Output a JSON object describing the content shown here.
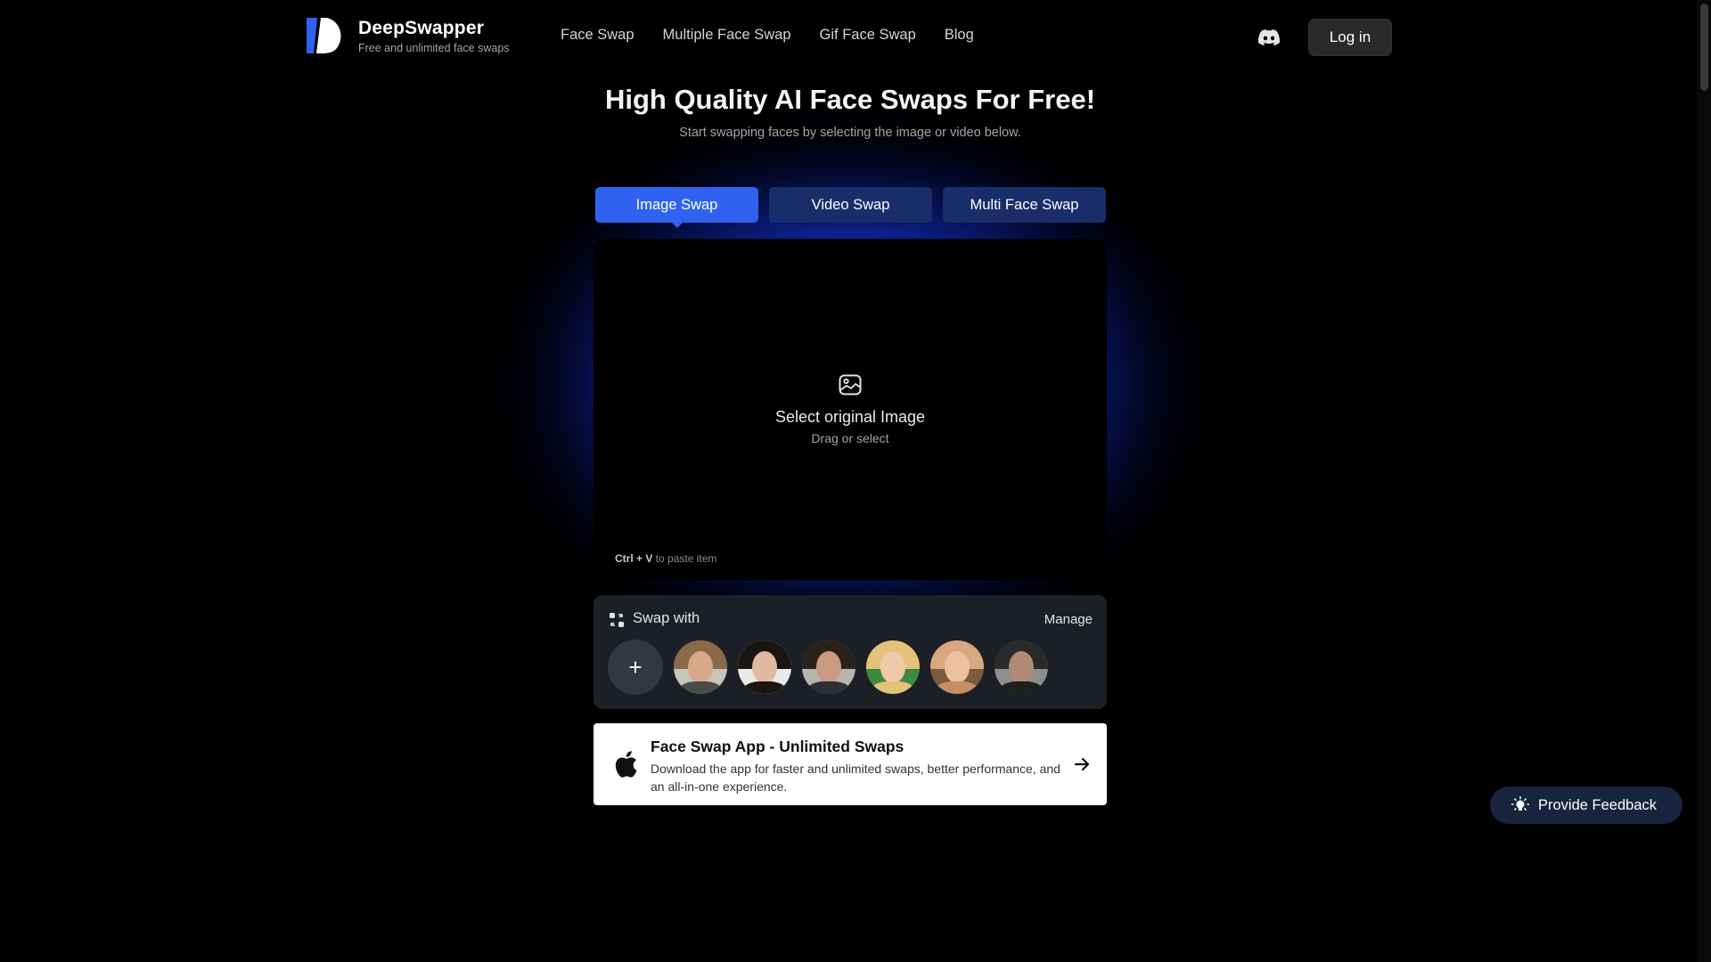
{
  "header": {
    "brand_name": "DeepSwapper",
    "brand_tagline": "Free and unlimited face swaps",
    "nav": [
      "Face Swap",
      "Multiple Face Swap",
      "Gif Face Swap",
      "Blog"
    ],
    "login_label": "Log in",
    "discord_icon": "discord-icon"
  },
  "hero": {
    "title": "High Quality AI Face Swaps For Free!",
    "subtitle": "Start swapping faces by selecting the image or video below."
  },
  "tabs": [
    {
      "label": "Image Swap",
      "active": true
    },
    {
      "label": "Video Swap",
      "active": false
    },
    {
      "label": "Multi Face Swap",
      "active": false
    }
  ],
  "dropzone": {
    "icon": "image-icon",
    "title": "Select original Image",
    "subtitle": "Drag or select",
    "paste_key": "Ctrl + V",
    "paste_text": "to paste item"
  },
  "swap_with": {
    "title": "Swap with",
    "manage_label": "Manage",
    "add_label": "+",
    "faces": [
      "face-1",
      "face-2",
      "face-3",
      "face-4",
      "face-5",
      "face-6"
    ]
  },
  "app_banner": {
    "title": "Face Swap App - Unlimited Swaps",
    "description": "Download the app for faster and unlimited swaps, better performance, and an all-in-one experience."
  },
  "feedback": {
    "label": "Provide Feedback"
  },
  "colors": {
    "accent": "#2f62f0",
    "tab_inactive": "#1a2d6b",
    "glow": "#1e46ff",
    "background": "#000000"
  }
}
